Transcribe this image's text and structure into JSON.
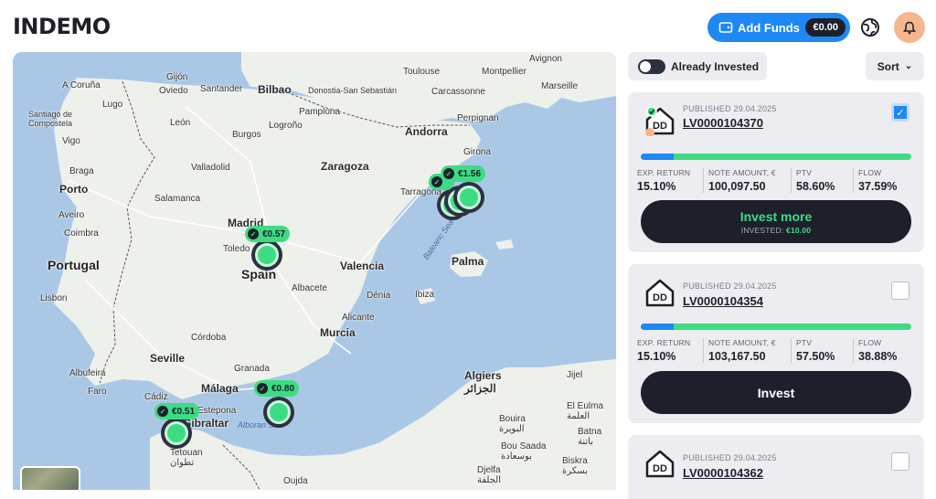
{
  "header": {
    "logo": "INDEMO",
    "add_funds_label": "Add Funds",
    "balance": "€0.00"
  },
  "map": {
    "labels": {
      "toulouse": "Toulouse",
      "montpellier": "Montpellier",
      "marseille": "Marseille",
      "avignon": "Avignon",
      "carcassonne": "Carcassonne",
      "perpignan": "Perpignan",
      "andorra": "Andorra",
      "girona": "Girona",
      "a_coruna": "A Coruña",
      "gijon": "Gijón",
      "oviedo": "Oviedo",
      "santander": "Santander",
      "bilbao": "Bilbao",
      "donostia": "Donostia-San Sebastián",
      "pamplona": "Pamplona",
      "lugo": "Lugo",
      "santiago": "Santiago de Compostela",
      "leon": "León",
      "burgos": "Burgos",
      "logrono": "Logroño",
      "vigo": "Vigo",
      "zaragoza": "Zaragoza",
      "valladolid": "Valladolid",
      "braga": "Braga",
      "porto": "Porto",
      "tarragona": "Tarragona",
      "salamanca": "Salamanca",
      "aveiro": "Aveiro",
      "madrid": "Madrid",
      "coimbra": "Coimbra",
      "toledo": "Toledo",
      "spain": "Spain",
      "portugal": "Portugal",
      "valencia": "Valencia",
      "palma": "Palma",
      "lisbon": "Lisbon",
      "albacete": "Albacete",
      "denia": "Dénia",
      "ibiza": "Ibiza",
      "alicante": "Alicante",
      "murcia": "Murcia",
      "cordoba": "Córdoba",
      "seville": "Seville",
      "albufeira": "Albufeira",
      "faro": "Faro",
      "granada": "Granada",
      "malaga": "Málaga",
      "cadiz": "Cádiz",
      "estepona": "Estepona",
      "gibraltar": "Gibraltar",
      "tetouan": "Tetouan تطوان",
      "algiers": "Algiers الجزائر",
      "jijel": "Jijel",
      "el_eulma": "El Eulma العلمة",
      "batna": "Batna باتنة",
      "bouira": "Bouira البويرة",
      "bou_saada": "Bou Saada بوسعادة",
      "djelfa": "Djelfa الجلفة",
      "biskra": "Biskra بسكرة",
      "oujda": "Oujda",
      "balearic": "Balearic Sea",
      "alboran": "Alboran Sea"
    },
    "pins": {
      "madrid": "€0.57",
      "barcelona": "€1.56",
      "almeria": "€0.80",
      "gibraltar": "€0.51"
    }
  },
  "filters": {
    "already_invested": "Already Invested",
    "sort": "Sort"
  },
  "labels": {
    "exp_return": "EXP. RETURN",
    "note_amount": "NOTE AMOUNT, €",
    "ptv": "PTV",
    "flow": "FLOW"
  },
  "loans": [
    {
      "published": "PUBLISHED 29.04.2025",
      "id": "LV0000104370",
      "checked": true,
      "progress": 0.12,
      "exp_return": "15.10%",
      "note_amount": "100,097.50",
      "ptv": "58.60%",
      "flow": "37.59%",
      "button": "Invest more",
      "invested_label": "INVESTED:",
      "invested_value": "€10.00"
    },
    {
      "published": "PUBLISHED 29.04.2025",
      "id": "LV0000104354",
      "checked": false,
      "progress": 0.12,
      "exp_return": "15.10%",
      "note_amount": "103,167.50",
      "ptv": "57.50%",
      "flow": "38.88%",
      "button": "Invest"
    },
    {
      "published": "PUBLISHED 29.04.2025",
      "id": "LV0000104362",
      "checked": false
    }
  ],
  "colors": {
    "accent_blue": "#1e88f5",
    "accent_green": "#3ddc84",
    "dark": "#1d1f2b",
    "card_bg": "#ececf1"
  }
}
